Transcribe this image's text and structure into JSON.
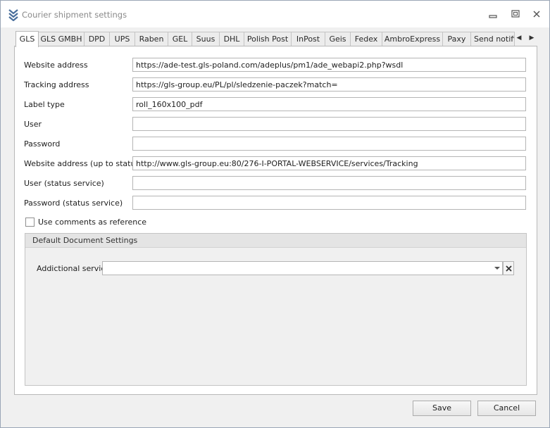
{
  "window": {
    "title": "Courier shipment settings",
    "icon": "chevrons-down-icon",
    "controls": [
      "minimize-icon",
      "maximize-icon",
      "close-icon"
    ]
  },
  "tabs": [
    {
      "label": "GLS",
      "active": true
    },
    {
      "label": "GLS GMBH"
    },
    {
      "label": "DPD"
    },
    {
      "label": "UPS"
    },
    {
      "label": "Raben"
    },
    {
      "label": "GEL"
    },
    {
      "label": "Suus"
    },
    {
      "label": "DHL"
    },
    {
      "label": "Polish Post"
    },
    {
      "label": "InPost"
    },
    {
      "label": "Geis"
    },
    {
      "label": "Fedex"
    },
    {
      "label": "AmbroExpress"
    },
    {
      "label": "Paxy"
    },
    {
      "label": "Send notific"
    }
  ],
  "tab_scroll": {
    "left": "◀",
    "right": "▶"
  },
  "fields": [
    {
      "label": "Website address",
      "value": "https://ade-test.gls-poland.com/adeplus/pm1/ade_webapi2.php?wsdl"
    },
    {
      "label": "Tracking address",
      "value": "https://gls-group.eu/PL/pl/sledzenie-paczek?match="
    },
    {
      "label": "Label type",
      "value": "roll_160x100_pdf"
    },
    {
      "label": "User",
      "value": ""
    },
    {
      "label": "Password",
      "value": ""
    },
    {
      "label": "Website address (up to status)",
      "value": "http://www.gls-group.eu:80/276-I-PORTAL-WEBSERVICE/services/Tracking"
    },
    {
      "label": "User (status service)",
      "value": ""
    },
    {
      "label": "Password (status service)",
      "value": ""
    }
  ],
  "use_comments": {
    "label": "Use comments as reference",
    "checked": false
  },
  "default_docs": {
    "title": "Default Document Settings",
    "additional_service_label": "Addictional service",
    "additional_service_value": ""
  },
  "buttons": {
    "save": "Save",
    "cancel": "Cancel"
  },
  "colors": {
    "window_border": "#9aa6b6",
    "app_icon": "#4a6f9c"
  }
}
